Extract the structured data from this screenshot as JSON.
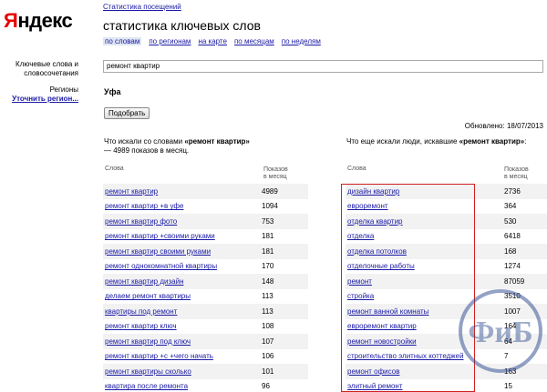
{
  "logo": {
    "first": "Я",
    "rest": "ндекс"
  },
  "top_link": "Статистика посещений",
  "title": "статистика ключевых слов",
  "tabs": [
    {
      "label": "по словам",
      "active": true
    },
    {
      "label": "по регионам",
      "active": false
    },
    {
      "label": "на карте",
      "active": false
    },
    {
      "label": "по месяцам",
      "active": false
    },
    {
      "label": "по неделям",
      "active": false
    }
  ],
  "sidebar": {
    "keywords_label_1": "Ключевые слова и",
    "keywords_label_2": "словосочетания",
    "regions_label": "Регионы",
    "regions_link": "Уточнить регион..."
  },
  "search": {
    "value": "ремонт квартир"
  },
  "region": "Уфа",
  "submit_button": "Подобрать",
  "updated": "Обновлено:  18/07/2013",
  "left": {
    "heading_1": "Что искали со словами ",
    "heading_bold": "«ремонт квартир»",
    "heading_2": " — 4989 показов в месяц.",
    "col_words": "Слова",
    "col_shows_1": "Показов",
    "col_shows_2": "в месяц",
    "rows": [
      {
        "k": "ремонт квартир",
        "v": "4989"
      },
      {
        "k": "ремонт квартир +в уфе",
        "v": "1094"
      },
      {
        "k": "ремонт квартир фото",
        "v": "753"
      },
      {
        "k": "ремонт квартир +своими руками",
        "v": "181"
      },
      {
        "k": "ремонт квартир своими руками",
        "v": "181"
      },
      {
        "k": "ремонт однокомнатной квартиры",
        "v": "170"
      },
      {
        "k": "ремонт квартир дизайн",
        "v": "148"
      },
      {
        "k": "делаем ремонт квартиры",
        "v": "113"
      },
      {
        "k": "квартиры под ремонт",
        "v": "113"
      },
      {
        "k": "ремонт квартир ключ",
        "v": "108"
      },
      {
        "k": "ремонт квартир под ключ",
        "v": "107"
      },
      {
        "k": "ремонт квартир +с +чего начать",
        "v": "106"
      },
      {
        "k": "ремонт квартиры сколько",
        "v": "101"
      },
      {
        "k": "квартира после ремонта",
        "v": "96"
      }
    ]
  },
  "right": {
    "heading_1": "Что еще искали люди, искавшие ",
    "heading_bold": "«ремонт квартир»",
    "heading_2": ":",
    "col_words": "Слова",
    "col_shows_1": "Показов",
    "col_shows_2": "в месяц",
    "rows": [
      {
        "k": "дизайн квартир",
        "v": "2736"
      },
      {
        "k": "евроремонт",
        "v": "364"
      },
      {
        "k": "отделка квартир",
        "v": "530"
      },
      {
        "k": "отделка",
        "v": "6418"
      },
      {
        "k": "отделка потолков",
        "v": "168"
      },
      {
        "k": "отделочные работы",
        "v": "1274"
      },
      {
        "k": "ремонт",
        "v": "87059"
      },
      {
        "k": "стройка",
        "v": "3510"
      },
      {
        "k": "ремонт ванной комнаты",
        "v": "1007"
      },
      {
        "k": "евроремонт квартир",
        "v": "164"
      },
      {
        "k": "ремонт новостройки",
        "v": "64"
      },
      {
        "k": "строительство элитных коттеджей",
        "v": "7"
      },
      {
        "k": "ремонт офисов",
        "v": "163"
      },
      {
        "k": "элитный ремонт",
        "v": "15"
      }
    ]
  },
  "watermark": {
    "text": "ФиБ",
    "color": "#2f4f9a"
  },
  "colors": {
    "link": "#1a1aa6",
    "logo_red": "#e60000",
    "highlight_box": "#d02020",
    "row_alt": "#f2f2f2"
  }
}
